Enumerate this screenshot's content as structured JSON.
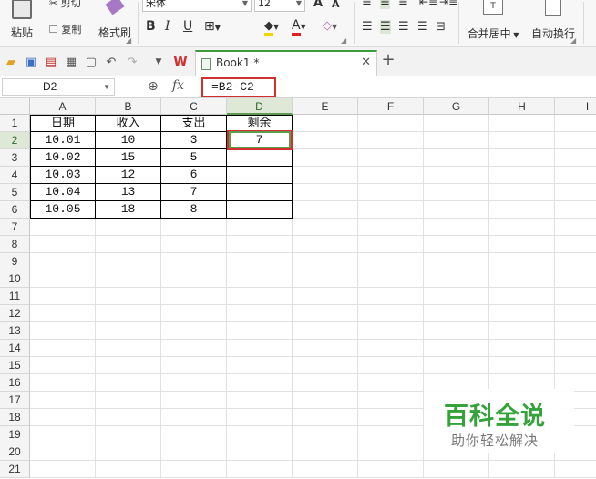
{
  "ribbon": {
    "paste_label": "粘贴",
    "cut_label": "剪切",
    "copy_label": "复制",
    "format_painter_label": "格式刷",
    "font_name": "宋体",
    "font_size": "12",
    "grow_font": "A",
    "shrink_font": "A",
    "bold": "B",
    "italic": "I",
    "underline": "U",
    "merge_center_label": "合并居中",
    "wrap_text_label": "自动换行"
  },
  "toolbar": {
    "doc_tab_title": "Book1 *",
    "new_tab": "+"
  },
  "formula_bar": {
    "name_box": "D2",
    "fx": "fx",
    "formula": "=B2-C2"
  },
  "columns": [
    "A",
    "B",
    "C",
    "D",
    "E",
    "F",
    "G",
    "H",
    "I"
  ],
  "rows": [
    "1",
    "2",
    "3",
    "4",
    "5",
    "6",
    "7",
    "8",
    "9",
    "10",
    "11",
    "12",
    "13",
    "14",
    "15",
    "16",
    "17",
    "18",
    "19",
    "20",
    "21"
  ],
  "table": {
    "headers": [
      "日期",
      "收入",
      "支出",
      "剩余"
    ],
    "data": [
      [
        "10.01",
        "10",
        "3",
        "7"
      ],
      [
        "10.02",
        "15",
        "5",
        ""
      ],
      [
        "10.03",
        "12",
        "6",
        ""
      ],
      [
        "10.04",
        "13",
        "7",
        ""
      ],
      [
        "10.05",
        "18",
        "8",
        ""
      ]
    ]
  },
  "active_cell": "D2",
  "watermark": {
    "title": "百科全说",
    "subtitle": "助你轻松解决"
  },
  "colors": {
    "accent_green": "#3e9a3e",
    "highlight_red": "#d0302f",
    "watermark_green": "#33a33a"
  }
}
